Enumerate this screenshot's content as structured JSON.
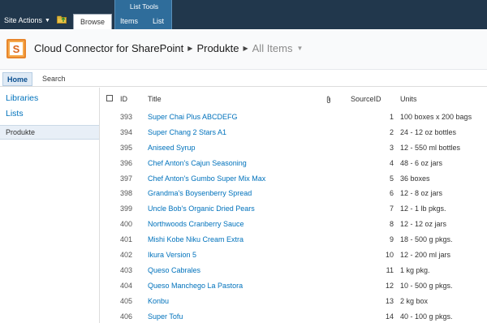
{
  "ribbon": {
    "site_actions": "Site Actions",
    "contextual_group": "List Tools",
    "tabs": [
      "Browse",
      "Items",
      "List"
    ]
  },
  "title_area": {
    "site_title": "Cloud Connector for SharePoint",
    "list_name": "Produkte",
    "view_name": "All Items"
  },
  "topnav": {
    "items": [
      "Home",
      "Search"
    ]
  },
  "quicklaunch": {
    "headings": [
      "Libraries",
      "Lists"
    ],
    "items": [
      "Produkte"
    ]
  },
  "list": {
    "columns": {
      "id": "ID",
      "title": "Title",
      "source_id": "SourceID",
      "units": "Units"
    },
    "rows": [
      {
        "id": "393",
        "title": "Super Chai Plus ABCDEFG",
        "source_id": "1",
        "units": "100 boxes x 200 bags"
      },
      {
        "id": "394",
        "title": "Super Chang 2 Stars A1",
        "source_id": "2",
        "units": "24 - 12 oz bottles"
      },
      {
        "id": "395",
        "title": "Aniseed Syrup",
        "source_id": "3",
        "units": "12 - 550 ml bottles"
      },
      {
        "id": "396",
        "title": "Chef Anton's Cajun Seasoning",
        "source_id": "4",
        "units": "48 - 6 oz jars"
      },
      {
        "id": "397",
        "title": "Chef Anton's Gumbo Super Mix Max",
        "source_id": "5",
        "units": "36 boxes"
      },
      {
        "id": "398",
        "title": "Grandma's Boysenberry Spread",
        "source_id": "6",
        "units": "12 - 8 oz jars"
      },
      {
        "id": "399",
        "title": "Uncle Bob's Organic Dried Pears",
        "source_id": "7",
        "units": "12 - 1 lb pkgs."
      },
      {
        "id": "400",
        "title": "Northwoods Cranberry Sauce",
        "source_id": "8",
        "units": "12 - 12 oz jars"
      },
      {
        "id": "401",
        "title": "Mishi Kobe Niku Cream Extra",
        "source_id": "9",
        "units": "18 - 500 g pkgs."
      },
      {
        "id": "402",
        "title": "Ikura Version 5",
        "source_id": "10",
        "units": "12 - 200 ml jars"
      },
      {
        "id": "403",
        "title": "Queso Cabrales",
        "source_id": "11",
        "units": "1 kg pkg."
      },
      {
        "id": "404",
        "title": "Queso Manchego La Pastora",
        "source_id": "12",
        "units": "10 - 500 g pkgs."
      },
      {
        "id": "405",
        "title": "Konbu",
        "source_id": "13",
        "units": "2 kg box"
      },
      {
        "id": "406",
        "title": "Super Tofu",
        "source_id": "14",
        "units": "40 - 100 g pkgs."
      }
    ]
  },
  "colors": {
    "ribbon": "#21374c",
    "contextual": "#2f6d9b",
    "link": "#0072bc",
    "selected_nav": "#e8eff7"
  },
  "icons": [
    "navigate-up-icon",
    "site-logo-icon",
    "attachment-icon"
  ]
}
